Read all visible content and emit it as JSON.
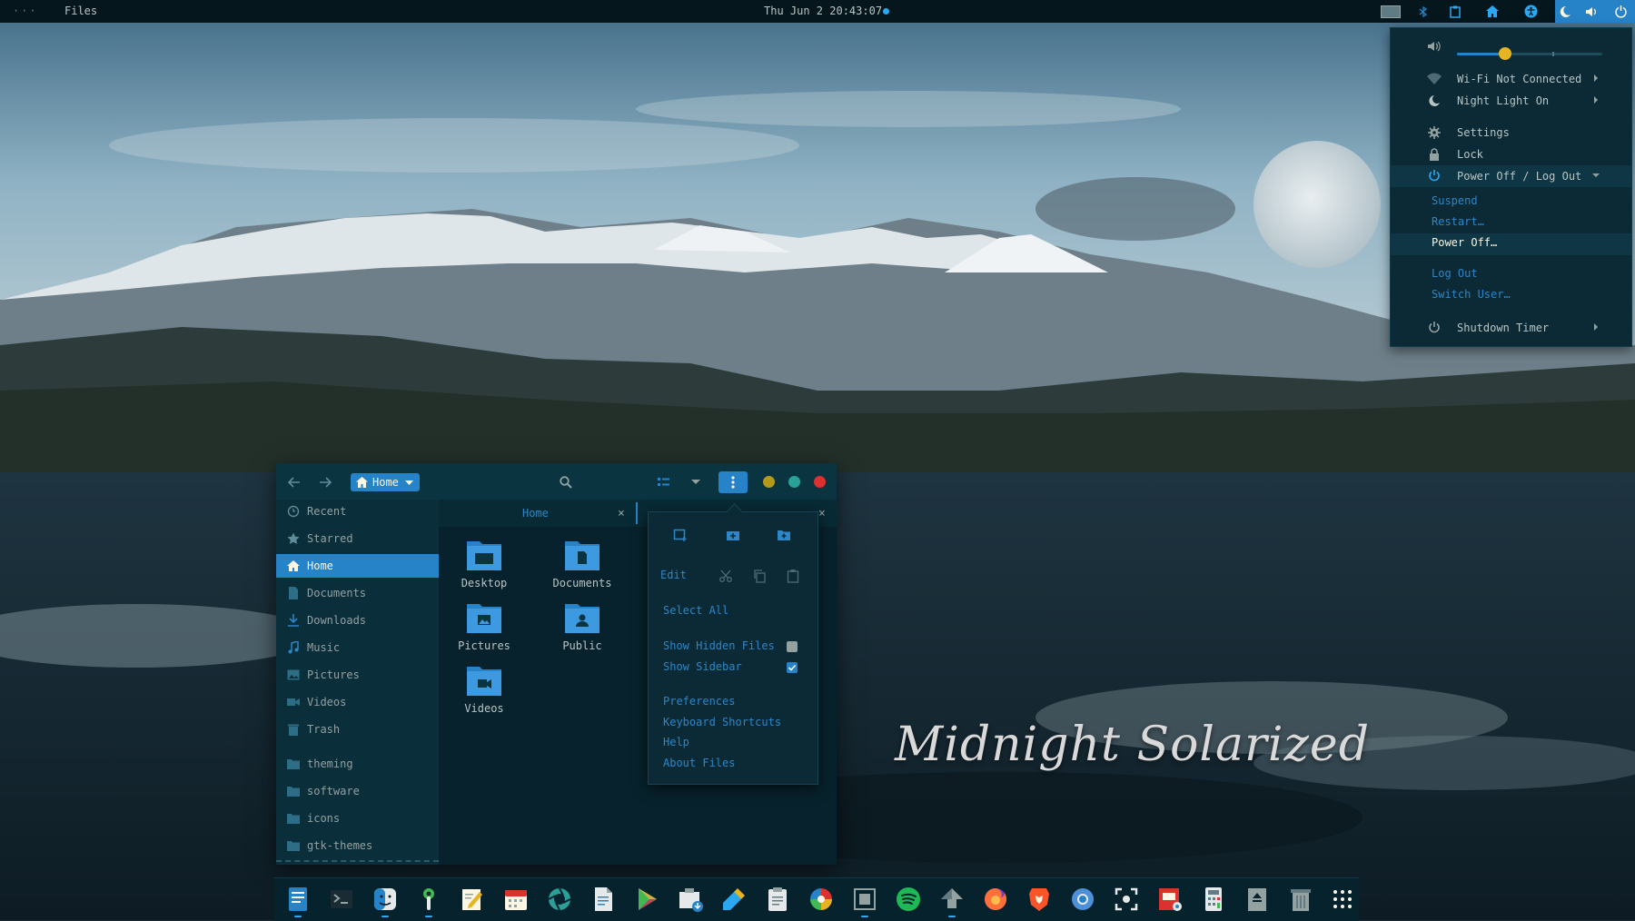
{
  "topbar": {
    "dots": "···",
    "app_name": "Files",
    "clock": "Thu Jun 2 20:43:07"
  },
  "colors": {
    "accent": "#2683c8",
    "topbar": "#05161c",
    "panel": "#0b2a35",
    "link_text": "#2d86c9",
    "yellow": "#e6b422",
    "minimize": "#b59a1a",
    "maximize": "#2aa198",
    "close": "#dc322f"
  },
  "system_menu": {
    "volume_level": 0.33,
    "wifi": "Wi-Fi Not Connected",
    "night_light": "Night Light On",
    "settings": "Settings",
    "lock": "Lock",
    "power": "Power Off / Log Out",
    "suspend": "Suspend",
    "restart": "Restart…",
    "power_off": "Power Off…",
    "log_out": "Log Out",
    "switch_user": "Switch User…",
    "shutdown_timer": "Shutdown Timer"
  },
  "files": {
    "breadcrumb": "Home",
    "sidebar": [
      {
        "label": "Recent",
        "icon": "clock-icon"
      },
      {
        "label": "Starred",
        "icon": "star-icon"
      },
      {
        "label": "Home",
        "icon": "home-icon",
        "selected": true
      },
      {
        "label": "Documents",
        "icon": "document-icon"
      },
      {
        "label": "Downloads",
        "icon": "download-icon"
      },
      {
        "label": "Music",
        "icon": "music-icon"
      },
      {
        "label": "Pictures",
        "icon": "image-icon"
      },
      {
        "label": "Videos",
        "icon": "video-icon"
      },
      {
        "label": "Trash",
        "icon": "trash-icon"
      },
      {
        "label": "theming",
        "icon": "folder-icon"
      },
      {
        "label": "software",
        "icon": "folder-icon"
      },
      {
        "label": "icons",
        "icon": "folder-icon"
      },
      {
        "label": "gtk-themes",
        "icon": "folder-icon"
      }
    ],
    "tab_label": "Home",
    "tab_close": "×",
    "items": [
      {
        "label": "Desktop",
        "icon": "desktop-folder-icon"
      },
      {
        "label": "Documents",
        "icon": "documents-folder-icon"
      },
      {
        "label": "Pictures",
        "icon": "pictures-folder-icon"
      },
      {
        "label": "Public",
        "icon": "public-folder-icon"
      },
      {
        "label": "Videos",
        "icon": "videos-folder-icon"
      }
    ]
  },
  "menu_popover": {
    "edit": "Edit",
    "select_all": "Select All",
    "show_hidden": "Show Hidden Files",
    "show_hidden_checked": false,
    "show_sidebar": "Show Sidebar",
    "show_sidebar_checked": true,
    "preferences": "Preferences",
    "keyboard_shortcuts": "Keyboard Shortcuts",
    "help": "Help",
    "about": "About Files"
  },
  "brand_text": "Midnight Solarized",
  "dock": [
    "files-icon",
    "terminal-icon",
    "finder-icon",
    "tweaks-icon",
    "text-editor-icon",
    "calendar-icon",
    "camera-aperture-icon",
    "document-viewer-icon",
    "play-store-icon",
    "package-installer-icon",
    "color-picker-icon",
    "clipboard-icon",
    "color-wheel-icon",
    "screenshot-frame-icon",
    "spotify-icon",
    "upload-icon",
    "firefox-icon",
    "brave-icon",
    "chromium-icon",
    "screenshot-icon",
    "presentation-icon",
    "calculator-icon",
    "archive-icon",
    "trash-bin-icon",
    "app-grid-icon"
  ]
}
